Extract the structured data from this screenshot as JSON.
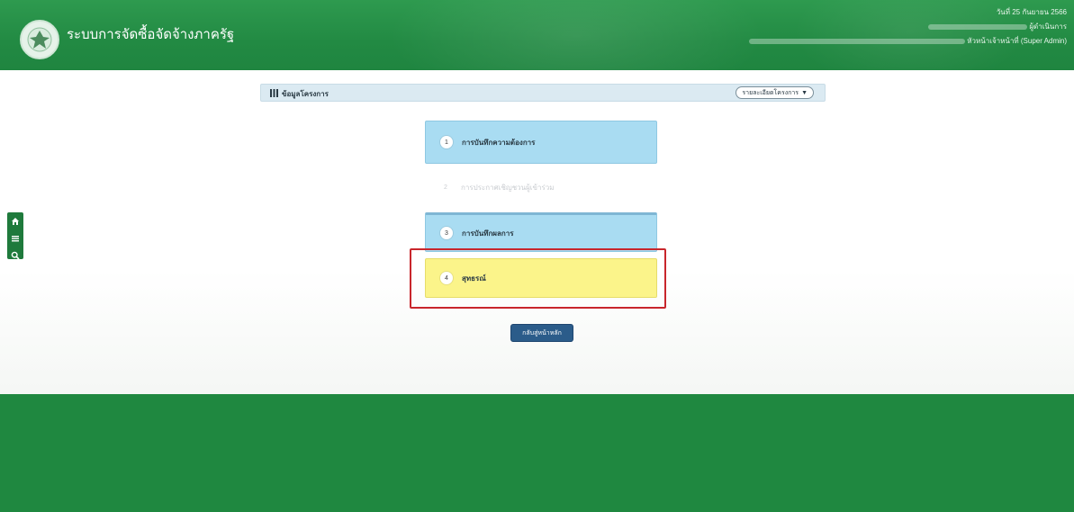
{
  "header": {
    "system_title": "ระบบการจัดซื้อจัดจ้างภาครัฐ",
    "system_subtitle": "",
    "date_text": "วันที่ 25 กันยายน 2566",
    "user_text": "ผู้ดำเนินการ",
    "role_text": "หัวหน้าเจ้าหน้าที่ (Super Admin)"
  },
  "side_tools": {
    "icons": [
      "home-icon",
      "menu-icon",
      "search-icon"
    ]
  },
  "project_bar": {
    "label": "ข้อมูลโครงการ",
    "detail_button": "รายละเอียดโครงการ"
  },
  "steps": [
    {
      "number": "1",
      "label": "การบันทึกความต้องการ",
      "state": "active"
    },
    {
      "number": "2",
      "label": "การประกาศเชิญชวนผู้เข้าร่วม",
      "state": "disabled"
    },
    {
      "number": "3",
      "label": "การบันทึกผลการ",
      "state": "active"
    },
    {
      "number": "4",
      "label": "สุทธรณ์",
      "state": "current"
    }
  ],
  "back_button": "กลับสู่หน้าหลัก",
  "footer": {
    "text": "",
    "version": ""
  },
  "colors": {
    "header_green": "#228a43",
    "footer_green": "#1f8840",
    "step_blue": "#a9dcf2",
    "step_yellow": "#fbf48a",
    "highlight_red": "#c8262c",
    "button_blue": "#2b5c8a"
  }
}
